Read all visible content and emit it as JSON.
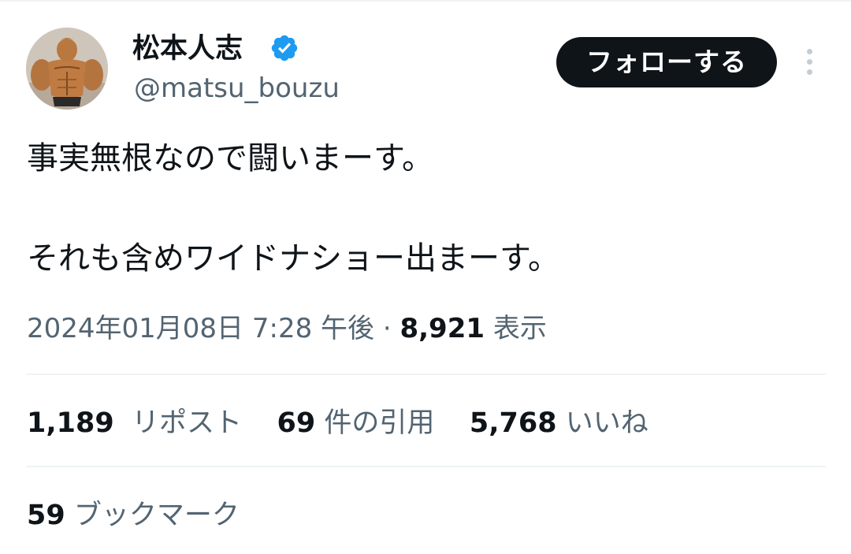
{
  "user": {
    "display_name": "松本人志",
    "handle": "@matsu_bouzu",
    "avatar_icon": "muscle-figure-avatar",
    "verified_icon": "verified-badge-icon",
    "verified_color": "#1d9bf0"
  },
  "actions": {
    "follow_label": "フォローする",
    "more_icon": "more-vertical-icon"
  },
  "tweet": {
    "lines": [
      "事実無根なので闘いまーす。",
      "それも含めワイドナショー出まーす。"
    ],
    "timestamp": "2024年01月08日 7:28 午後",
    "separator": " · ",
    "views_count": "8,921",
    "views_label": "表示"
  },
  "stats": {
    "reposts_count": "1,189",
    "reposts_label": "リポスト",
    "quotes_count": "69",
    "quotes_label": "件の引用",
    "likes_count": "5,768",
    "likes_label": "いいね",
    "bookmarks_count": "59",
    "bookmarks_label": "ブックマーク"
  },
  "colors": {
    "text_primary": "#0f1419",
    "text_secondary": "#536471",
    "divider": "#eff3f4",
    "button_bg": "#0f1419"
  }
}
